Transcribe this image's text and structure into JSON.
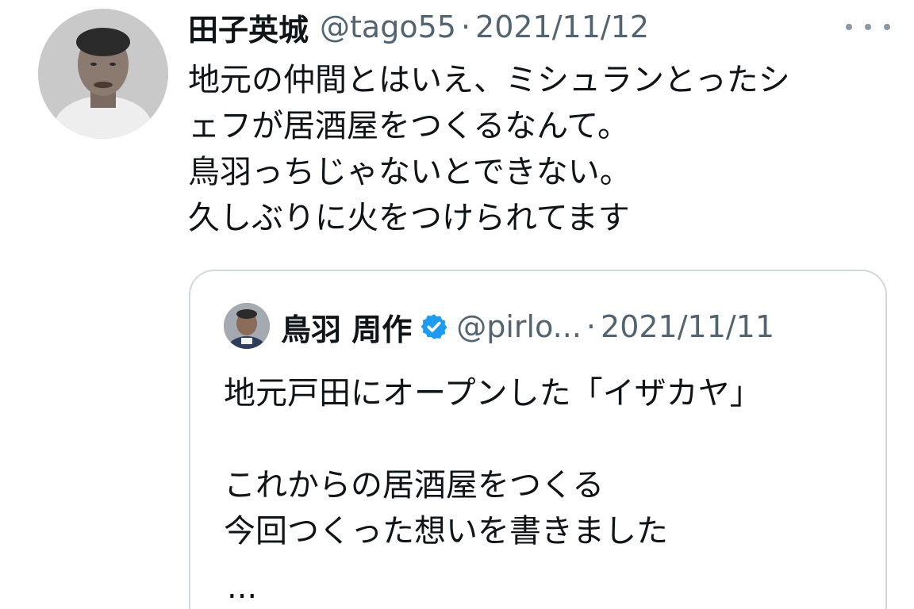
{
  "tweet": {
    "author_name": "田子英城",
    "handle": "@tago55",
    "separator": "·",
    "date": "2021/11/12",
    "text_lines": [
      "地元の仲間とはいえ、ミシュランとったシ",
      "ェフが居酒屋をつくるなんて。",
      "鳥羽っちじゃないとできない。",
      "久しぶりに火をつけられてます"
    ],
    "icons": {
      "more": "more-horizontal-icon",
      "avatar": "avatar-photo"
    }
  },
  "quote": {
    "author_name": "鳥羽 周作",
    "handle": "@pirlo...",
    "separator": "·",
    "date": "2021/11/11",
    "verified_color": "#1d9bf0",
    "text_lines": [
      "地元戸田にオープンした「イザカヤ」",
      "",
      "これからの居酒屋をつくる",
      "今回つくった想いを書きました"
    ],
    "truncation": "...",
    "icons": {
      "verified": "verified-badge-icon",
      "avatar": "avatar-photo"
    }
  },
  "colors": {
    "text_primary": "#0f1419",
    "text_secondary": "#536471",
    "border": "#cfd9de"
  }
}
